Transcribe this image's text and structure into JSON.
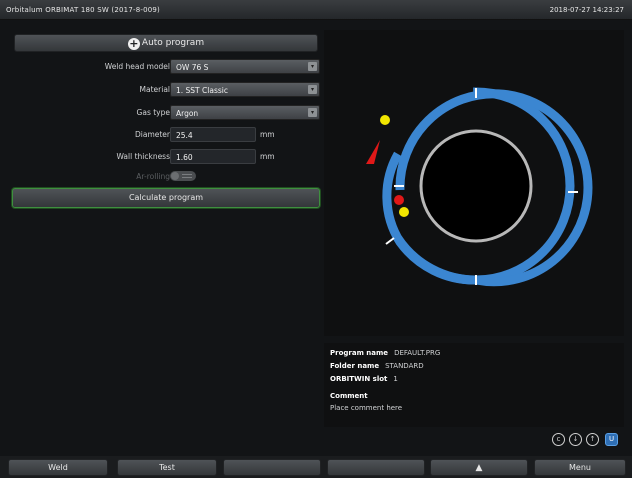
{
  "titlebar": {
    "title": "Orbitalum ORBIMAT 180 SW (2017-8-009)",
    "clock": "2018-07-27 14:23:27"
  },
  "form": {
    "auto_program_label": "Auto program",
    "weld_head": {
      "label": "Weld head model",
      "value": "OW 76 S"
    },
    "material": {
      "label": "Material",
      "value": "1. SST Classic"
    },
    "gas_type": {
      "label": "Gas type",
      "value": "Argon"
    },
    "diameter": {
      "label": "Diameter",
      "value": "25.4",
      "unit": "mm"
    },
    "wall_thickness": {
      "label": "Wall thickness",
      "value": "1.60",
      "unit": "mm"
    },
    "toggle_label": "Ar-rolling",
    "calculate_label": "Calculate program"
  },
  "info": {
    "program_name_key": "Program name",
    "program_name_val": "DEFAULT.PRG",
    "folder_name_key": "Folder name",
    "folder_name_val": "STANDARD",
    "orbitwin_key": "ORBITWIN slot",
    "orbitwin_val": "1",
    "comment_key": "Comment",
    "comment_val": "Place comment here"
  },
  "status_icons": [
    "c-circle-icon",
    "download-circle-icon",
    "upload-circle-icon",
    "usb-icon"
  ],
  "bottom": {
    "weld": "Weld",
    "test": "Test",
    "blank1": "",
    "blank2": "",
    "home_icon": "triangle-up-icon",
    "menu": "Menu"
  },
  "colors": {
    "ring": "#3b86d1",
    "tube": "#000000",
    "tube_border": "#b8b8b8",
    "marker_yellow": "#f2e600",
    "marker_red": "#e01818",
    "accent_green": "#3f8f3f"
  }
}
